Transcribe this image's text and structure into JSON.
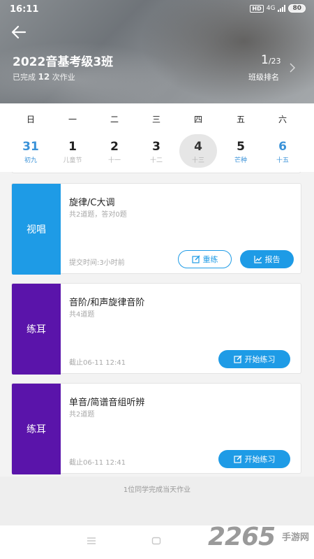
{
  "status_bar": {
    "time": "16:11",
    "hd": "HD",
    "network": "4G",
    "battery": "80"
  },
  "header": {
    "title": "2022音基考级3班",
    "subtitle_prefix": "已完成",
    "completed_count": "12",
    "subtitle_suffix": "次作业",
    "rank": "1",
    "rank_total": "/23",
    "rank_label": "班级排名"
  },
  "calendar": {
    "weekdays": [
      "日",
      "一",
      "二",
      "三",
      "四",
      "五",
      "六"
    ],
    "days": [
      {
        "num": "31",
        "lunar": "初九"
      },
      {
        "num": "1",
        "lunar": "儿童节"
      },
      {
        "num": "2",
        "lunar": "十一"
      },
      {
        "num": "3",
        "lunar": "十二"
      },
      {
        "num": "4",
        "lunar": "十三"
      },
      {
        "num": "5",
        "lunar": "芒种"
      },
      {
        "num": "6",
        "lunar": "十五"
      }
    ]
  },
  "assignments": [
    {
      "tag": "视唱",
      "title": "旋律/C大调",
      "desc": "共2道题，答对0题",
      "time": "提交时间:3小时前",
      "buttons": [
        "重练",
        "报告"
      ]
    },
    {
      "tag": "练耳",
      "title": "音阶/和声旋律音阶",
      "desc": "共4道题",
      "time": "截止06-11 12:41",
      "buttons": [
        "开始练习"
      ]
    },
    {
      "tag": "练耳",
      "title": "单音/简谱音组听辨",
      "desc": "共2道题",
      "time": "截止06-11 12:41",
      "buttons": [
        "开始练习"
      ]
    }
  ],
  "footer": {
    "text": "1位同学完成当天作业"
  },
  "watermark": {
    "number": "2265",
    "site": "手游网"
  },
  "colors": {
    "accent": "#1e9be6",
    "tag_sing": "#1e9be6",
    "tag_ear": "#5a14aa",
    "calendar_weekend": "#3a92d8"
  }
}
